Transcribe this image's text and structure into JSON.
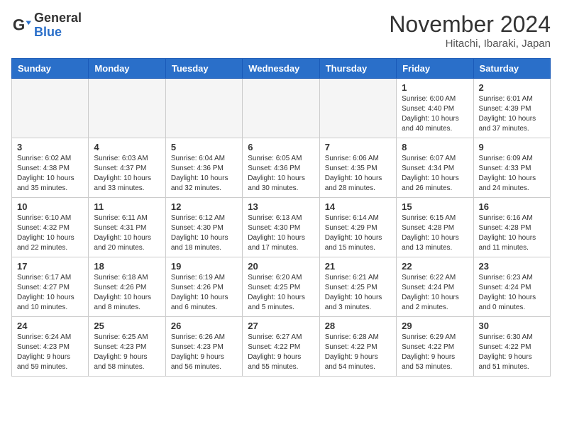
{
  "header": {
    "logo_general": "General",
    "logo_blue": "Blue",
    "month_title": "November 2024",
    "location": "Hitachi, Ibaraki, Japan"
  },
  "days_of_week": [
    "Sunday",
    "Monday",
    "Tuesday",
    "Wednesday",
    "Thursday",
    "Friday",
    "Saturday"
  ],
  "weeks": [
    [
      {
        "day": "",
        "info": ""
      },
      {
        "day": "",
        "info": ""
      },
      {
        "day": "",
        "info": ""
      },
      {
        "day": "",
        "info": ""
      },
      {
        "day": "",
        "info": ""
      },
      {
        "day": "1",
        "info": "Sunrise: 6:00 AM\nSunset: 4:40 PM\nDaylight: 10 hours and 40 minutes."
      },
      {
        "day": "2",
        "info": "Sunrise: 6:01 AM\nSunset: 4:39 PM\nDaylight: 10 hours and 37 minutes."
      }
    ],
    [
      {
        "day": "3",
        "info": "Sunrise: 6:02 AM\nSunset: 4:38 PM\nDaylight: 10 hours and 35 minutes."
      },
      {
        "day": "4",
        "info": "Sunrise: 6:03 AM\nSunset: 4:37 PM\nDaylight: 10 hours and 33 minutes."
      },
      {
        "day": "5",
        "info": "Sunrise: 6:04 AM\nSunset: 4:36 PM\nDaylight: 10 hours and 32 minutes."
      },
      {
        "day": "6",
        "info": "Sunrise: 6:05 AM\nSunset: 4:36 PM\nDaylight: 10 hours and 30 minutes."
      },
      {
        "day": "7",
        "info": "Sunrise: 6:06 AM\nSunset: 4:35 PM\nDaylight: 10 hours and 28 minutes."
      },
      {
        "day": "8",
        "info": "Sunrise: 6:07 AM\nSunset: 4:34 PM\nDaylight: 10 hours and 26 minutes."
      },
      {
        "day": "9",
        "info": "Sunrise: 6:09 AM\nSunset: 4:33 PM\nDaylight: 10 hours and 24 minutes."
      }
    ],
    [
      {
        "day": "10",
        "info": "Sunrise: 6:10 AM\nSunset: 4:32 PM\nDaylight: 10 hours and 22 minutes."
      },
      {
        "day": "11",
        "info": "Sunrise: 6:11 AM\nSunset: 4:31 PM\nDaylight: 10 hours and 20 minutes."
      },
      {
        "day": "12",
        "info": "Sunrise: 6:12 AM\nSunset: 4:30 PM\nDaylight: 10 hours and 18 minutes."
      },
      {
        "day": "13",
        "info": "Sunrise: 6:13 AM\nSunset: 4:30 PM\nDaylight: 10 hours and 17 minutes."
      },
      {
        "day": "14",
        "info": "Sunrise: 6:14 AM\nSunset: 4:29 PM\nDaylight: 10 hours and 15 minutes."
      },
      {
        "day": "15",
        "info": "Sunrise: 6:15 AM\nSunset: 4:28 PM\nDaylight: 10 hours and 13 minutes."
      },
      {
        "day": "16",
        "info": "Sunrise: 6:16 AM\nSunset: 4:28 PM\nDaylight: 10 hours and 11 minutes."
      }
    ],
    [
      {
        "day": "17",
        "info": "Sunrise: 6:17 AM\nSunset: 4:27 PM\nDaylight: 10 hours and 10 minutes."
      },
      {
        "day": "18",
        "info": "Sunrise: 6:18 AM\nSunset: 4:26 PM\nDaylight: 10 hours and 8 minutes."
      },
      {
        "day": "19",
        "info": "Sunrise: 6:19 AM\nSunset: 4:26 PM\nDaylight: 10 hours and 6 minutes."
      },
      {
        "day": "20",
        "info": "Sunrise: 6:20 AM\nSunset: 4:25 PM\nDaylight: 10 hours and 5 minutes."
      },
      {
        "day": "21",
        "info": "Sunrise: 6:21 AM\nSunset: 4:25 PM\nDaylight: 10 hours and 3 minutes."
      },
      {
        "day": "22",
        "info": "Sunrise: 6:22 AM\nSunset: 4:24 PM\nDaylight: 10 hours and 2 minutes."
      },
      {
        "day": "23",
        "info": "Sunrise: 6:23 AM\nSunset: 4:24 PM\nDaylight: 10 hours and 0 minutes."
      }
    ],
    [
      {
        "day": "24",
        "info": "Sunrise: 6:24 AM\nSunset: 4:23 PM\nDaylight: 9 hours and 59 minutes."
      },
      {
        "day": "25",
        "info": "Sunrise: 6:25 AM\nSunset: 4:23 PM\nDaylight: 9 hours and 58 minutes."
      },
      {
        "day": "26",
        "info": "Sunrise: 6:26 AM\nSunset: 4:23 PM\nDaylight: 9 hours and 56 minutes."
      },
      {
        "day": "27",
        "info": "Sunrise: 6:27 AM\nSunset: 4:22 PM\nDaylight: 9 hours and 55 minutes."
      },
      {
        "day": "28",
        "info": "Sunrise: 6:28 AM\nSunset: 4:22 PM\nDaylight: 9 hours and 54 minutes."
      },
      {
        "day": "29",
        "info": "Sunrise: 6:29 AM\nSunset: 4:22 PM\nDaylight: 9 hours and 53 minutes."
      },
      {
        "day": "30",
        "info": "Sunrise: 6:30 AM\nSunset: 4:22 PM\nDaylight: 9 hours and 51 minutes."
      }
    ]
  ]
}
